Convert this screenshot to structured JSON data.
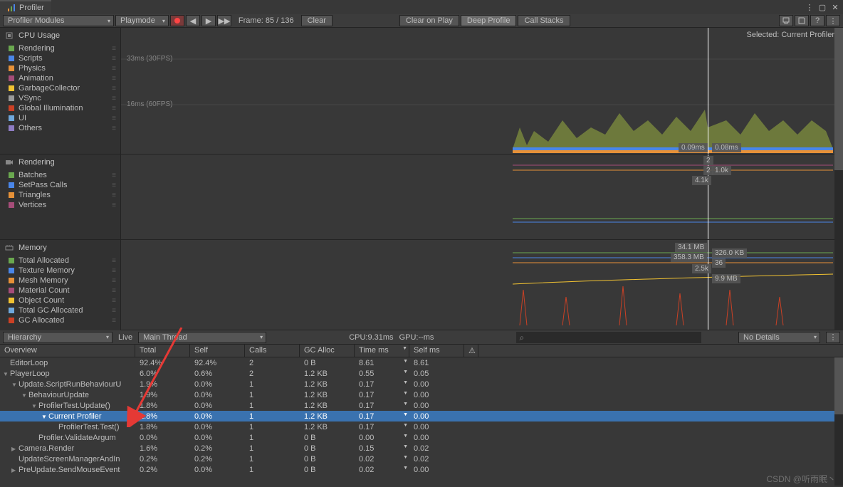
{
  "title": "Profiler",
  "toolbar": {
    "modules": "Profiler Modules",
    "playmode": "Playmode",
    "frame": "Frame: 85 / 136",
    "clear": "Clear",
    "clearOnPlay": "Clear on Play",
    "deepProfile": "Deep Profile",
    "callStacks": "Call Stacks"
  },
  "selected": "Selected: Current Profiler",
  "cpu": {
    "title": "CPU Usage",
    "label30": "33ms (30FPS)",
    "label60": "16ms (60FPS)",
    "tooltip1": "0.09ms",
    "tooltip2": "0.08ms",
    "tooltip3": "2",
    "tooltip4": "2",
    "tooltip5": "1.0k",
    "tooltip6": "4.1k",
    "cats": [
      {
        "c": "#6aa84f",
        "n": "Rendering"
      },
      {
        "c": "#4a86e8",
        "n": "Scripts"
      },
      {
        "c": "#e69138",
        "n": "Physics"
      },
      {
        "c": "#a64d79",
        "n": "Animation"
      },
      {
        "c": "#f1c232",
        "n": "GarbageCollector"
      },
      {
        "c": "#999999",
        "n": "VSync"
      },
      {
        "c": "#cc4125",
        "n": "Global Illumination"
      },
      {
        "c": "#6fa8dc",
        "n": "UI"
      },
      {
        "c": "#8e7cc3",
        "n": "Others"
      }
    ]
  },
  "rendering": {
    "title": "Rendering",
    "cats": [
      {
        "c": "#6aa84f",
        "n": "Batches"
      },
      {
        "c": "#4a86e8",
        "n": "SetPass Calls"
      },
      {
        "c": "#e69138",
        "n": "Triangles"
      },
      {
        "c": "#a64d79",
        "n": "Vertices"
      }
    ]
  },
  "memory": {
    "title": "Memory",
    "tooltip1": "34.1 MB",
    "tooltip2": "358.3 MB",
    "tooltip3": "2.5k",
    "tooltip4": "326.0 KB",
    "tooltip5": "36",
    "tooltip6": "9.9 MB",
    "cats": [
      {
        "c": "#6aa84f",
        "n": "Total Allocated"
      },
      {
        "c": "#4a86e8",
        "n": "Texture Memory"
      },
      {
        "c": "#e69138",
        "n": "Mesh Memory"
      },
      {
        "c": "#a64d79",
        "n": "Material Count"
      },
      {
        "c": "#f1c232",
        "n": "Object Count"
      },
      {
        "c": "#6fa8dc",
        "n": "Total GC Allocated"
      },
      {
        "c": "#cc4125",
        "n": "GC Allocated"
      }
    ]
  },
  "bottom": {
    "hierarchy": "Hierarchy",
    "live": "Live",
    "thread": "Main Thread",
    "cpuTime": "CPU:9.31ms",
    "gpuTime": "GPU:--ms",
    "noDetails": "No Details",
    "headers": [
      "Overview",
      "Total",
      "Self",
      "Calls",
      "GC Alloc",
      "Time ms",
      "Self ms",
      ""
    ],
    "rows": [
      {
        "i": 0,
        "a": "",
        "n": "EditorLoop",
        "t": "92.4%",
        "s": "92.4%",
        "c": "2",
        "g": "0 B",
        "tm": "8.61",
        "sm": "8.61"
      },
      {
        "i": 0,
        "a": "▼",
        "n": "PlayerLoop",
        "t": "6.0%",
        "s": "0.6%",
        "c": "2",
        "g": "1.2 KB",
        "tm": "0.55",
        "sm": "0.05"
      },
      {
        "i": 1,
        "a": "▼",
        "n": "Update.ScriptRunBehaviourU",
        "t": "1.9%",
        "s": "0.0%",
        "c": "1",
        "g": "1.2 KB",
        "tm": "0.17",
        "sm": "0.00"
      },
      {
        "i": 2,
        "a": "▼",
        "n": "BehaviourUpdate",
        "t": "1.9%",
        "s": "0.0%",
        "c": "1",
        "g": "1.2 KB",
        "tm": "0.17",
        "sm": "0.00"
      },
      {
        "i": 3,
        "a": "▼",
        "n": "ProfilerTest.Update()",
        "t": "1.8%",
        "s": "0.0%",
        "c": "1",
        "g": "1.2 KB",
        "tm": "0.17",
        "sm": "0.00"
      },
      {
        "i": 4,
        "a": "▼",
        "n": "Current Profiler",
        "t": "1.8%",
        "s": "0.0%",
        "c": "1",
        "g": "1.2 KB",
        "tm": "0.17",
        "sm": "0.00",
        "sel": true
      },
      {
        "i": 5,
        "a": "",
        "n": "ProfilerTest.Test()",
        "t": "1.8%",
        "s": "0.0%",
        "c": "1",
        "g": "1.2 KB",
        "tm": "0.17",
        "sm": "0.00"
      },
      {
        "i": 3,
        "a": "",
        "n": "Profiler.ValidateArgum",
        "t": "0.0%",
        "s": "0.0%",
        "c": "1",
        "g": "0 B",
        "tm": "0.00",
        "sm": "0.00"
      },
      {
        "i": 1,
        "a": "▶",
        "n": "Camera.Render",
        "t": "1.6%",
        "s": "0.2%",
        "c": "1",
        "g": "0 B",
        "tm": "0.15",
        "sm": "0.02"
      },
      {
        "i": 1,
        "a": "",
        "n": "UpdateScreenManagerAndIn",
        "t": "0.2%",
        "s": "0.2%",
        "c": "1",
        "g": "0 B",
        "tm": "0.02",
        "sm": "0.02"
      },
      {
        "i": 1,
        "a": "▶",
        "n": "PreUpdate.SendMouseEvent",
        "t": "0.2%",
        "s": "0.0%",
        "c": "1",
        "g": "0 B",
        "tm": "0.02",
        "sm": "0.00"
      }
    ]
  },
  "watermark": "CSDN @听雨眠丶",
  "chart_data": [
    {
      "type": "area",
      "title": "CPU Usage",
      "ylabel": "ms",
      "categories_sample": [
        0,
        136
      ],
      "series": [
        {
          "name": "Rendering",
          "values_approx": [
            0.5,
            0.7
          ]
        },
        {
          "name": "Scripts",
          "values_approx": [
            0.2,
            0.3
          ]
        },
        {
          "name": "Others",
          "values_approx": [
            4,
            8
          ]
        }
      ],
      "cursor_frame": 85,
      "marker_lines": [
        16,
        33
      ]
    },
    {
      "type": "line",
      "title": "Rendering",
      "series": [
        {
          "name": "Batches",
          "value_at_cursor": 2
        },
        {
          "name": "SetPass Calls",
          "value_at_cursor": 2
        },
        {
          "name": "Triangles",
          "value_at_cursor": 1000
        },
        {
          "name": "Vertices",
          "value_at_cursor": 4100
        }
      ]
    },
    {
      "type": "line",
      "title": "Memory",
      "series": [
        {
          "name": "Total Allocated",
          "value_at_cursor": "358.3 MB"
        },
        {
          "name": "Texture Memory",
          "value_at_cursor": "34.1 MB"
        },
        {
          "name": "Total GC Allocated",
          "value_at_cursor": "9.9 MB"
        },
        {
          "name": "GC Allocated",
          "value_at_cursor": "326.0 KB"
        },
        {
          "name": "Material Count",
          "value_at_cursor": 36
        },
        {
          "name": "Object Count",
          "value_at_cursor": 2500
        }
      ]
    }
  ]
}
